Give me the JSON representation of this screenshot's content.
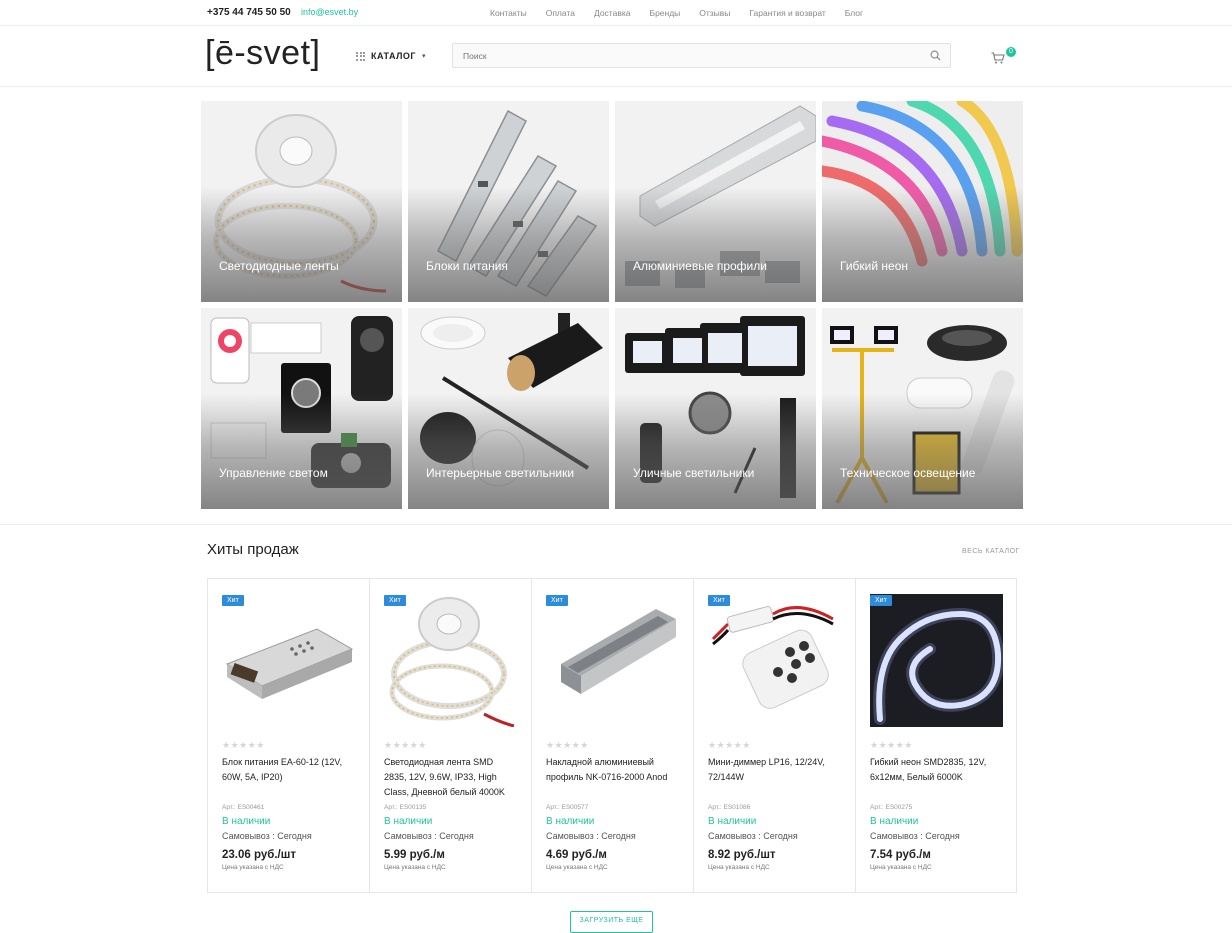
{
  "topbar": {
    "phone": "+375 44 745 50 50",
    "email": "info@esvet.by",
    "nav": [
      "Контакты",
      "Оплата",
      "Доставка",
      "Бренды",
      "Отзывы",
      "Гарантия и возврат",
      "Блог"
    ]
  },
  "header": {
    "logo": "[ē-svet]",
    "catalog_label": "КАТАЛОГ",
    "search_placeholder": "Поиск",
    "cart_count": "0"
  },
  "categories": [
    {
      "label": "Светодиодные ленты",
      "icon": "led-strip-reel"
    },
    {
      "label": "Блоки питания",
      "icon": "power-supply"
    },
    {
      "label": "Алюминиевые профили",
      "icon": "aluminum-profile"
    },
    {
      "label": "Гибкий неон",
      "icon": "flexible-neon"
    },
    {
      "label": "Управление светом",
      "icon": "light-controllers"
    },
    {
      "label": "Интерьерные светильники",
      "icon": "interior-lamps"
    },
    {
      "label": "Уличные светильники",
      "icon": "outdoor-lamps"
    },
    {
      "label": "Техническое освещение",
      "icon": "technical-lighting"
    }
  ],
  "bestsellers": {
    "title": "Хиты продаж",
    "all_link": "ВЕСЬ КАТАЛОГ",
    "products": [
      {
        "badge": "Хит",
        "name": "Блок питания EA-60-12 (12V, 60W, 5A, IP20)",
        "article": "Арт.: ES00461",
        "stock": "В наличии",
        "pickup": "Самовывоз : Сегодня",
        "price": "23.06 руб./шт",
        "vat": "Цена указана с НДС"
      },
      {
        "badge": "Хит",
        "name": "Светодиодная лента SMD 2835, 12V, 9.6W, IP33, High Class, Дневной белый 4000K",
        "article": "Арт.: ES00135",
        "stock": "В наличии",
        "pickup": "Самовывоз : Сегодня",
        "price": "5.99 руб./м",
        "vat": "Цена указана с НДС"
      },
      {
        "badge": "Хит",
        "name": "Накладной алюминиевый профиль NK-0716-2000 Anod",
        "article": "Арт.: ES00577",
        "stock": "В наличии",
        "pickup": "Самовывоз : Сегодня",
        "price": "4.69 руб./м",
        "vat": "Цена указана с НДС"
      },
      {
        "badge": "Хит",
        "name": "Мини-диммер LP16, 12/24V, 72/144W",
        "article": "Арт.: ES01086",
        "stock": "В наличии",
        "pickup": "Самовывоз : Сегодня",
        "price": "8.92 руб./шт",
        "vat": "Цена указана с НДС"
      },
      {
        "badge": "Хит",
        "name": "Гибкий неон SMD2835, 12V, 6x12мм, Белый 6000K",
        "article": "Арт.: ES00275",
        "stock": "В наличии",
        "pickup": "Самовывоз : Сегодня",
        "price": "7.54 руб./м",
        "vat": "Цена указана с НДС"
      }
    ],
    "load_more": "ЗАГРУЗИТЬ ЕЩЕ"
  },
  "colors": {
    "accent": "#20c3a0",
    "badge": "#2d8cd9"
  }
}
